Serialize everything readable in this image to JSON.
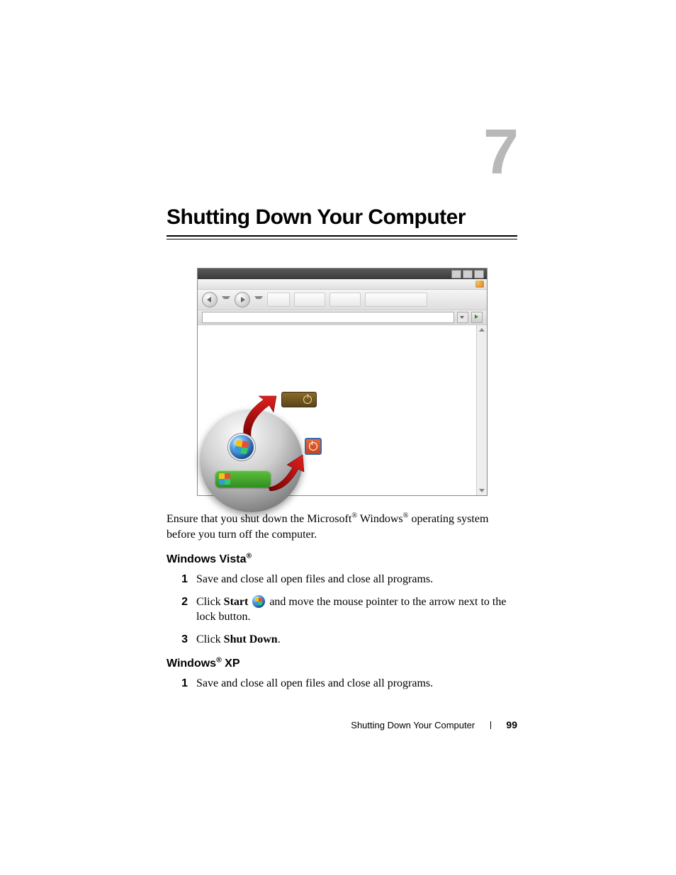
{
  "chapter": {
    "number": "7",
    "title": "Shutting Down Your Computer"
  },
  "intro": {
    "prefix": "Ensure that you shut down the Microsoft",
    "mid": " Windows",
    "suffix": " operating system before you turn off the computer."
  },
  "vista": {
    "heading": "Windows Vista",
    "steps": {
      "s1": {
        "n": "1",
        "text": "Save and close all open files and close all programs."
      },
      "s2": {
        "n": "2",
        "prefix": "Click ",
        "start": "Start",
        "suffix": " and move the mouse pointer to the arrow next to the lock button."
      },
      "s3": {
        "n": "3",
        "prefix": "Click ",
        "shutdown": "Shut Down",
        "suffix": "."
      }
    }
  },
  "xp": {
    "heading_prefix": "Windows",
    "heading_suffix": " XP",
    "steps": {
      "s1": {
        "n": "1",
        "text": "Save and close all open files and close all programs."
      }
    }
  },
  "footer": {
    "title": "Shutting Down Your Computer",
    "page": "99"
  },
  "reg": "®"
}
